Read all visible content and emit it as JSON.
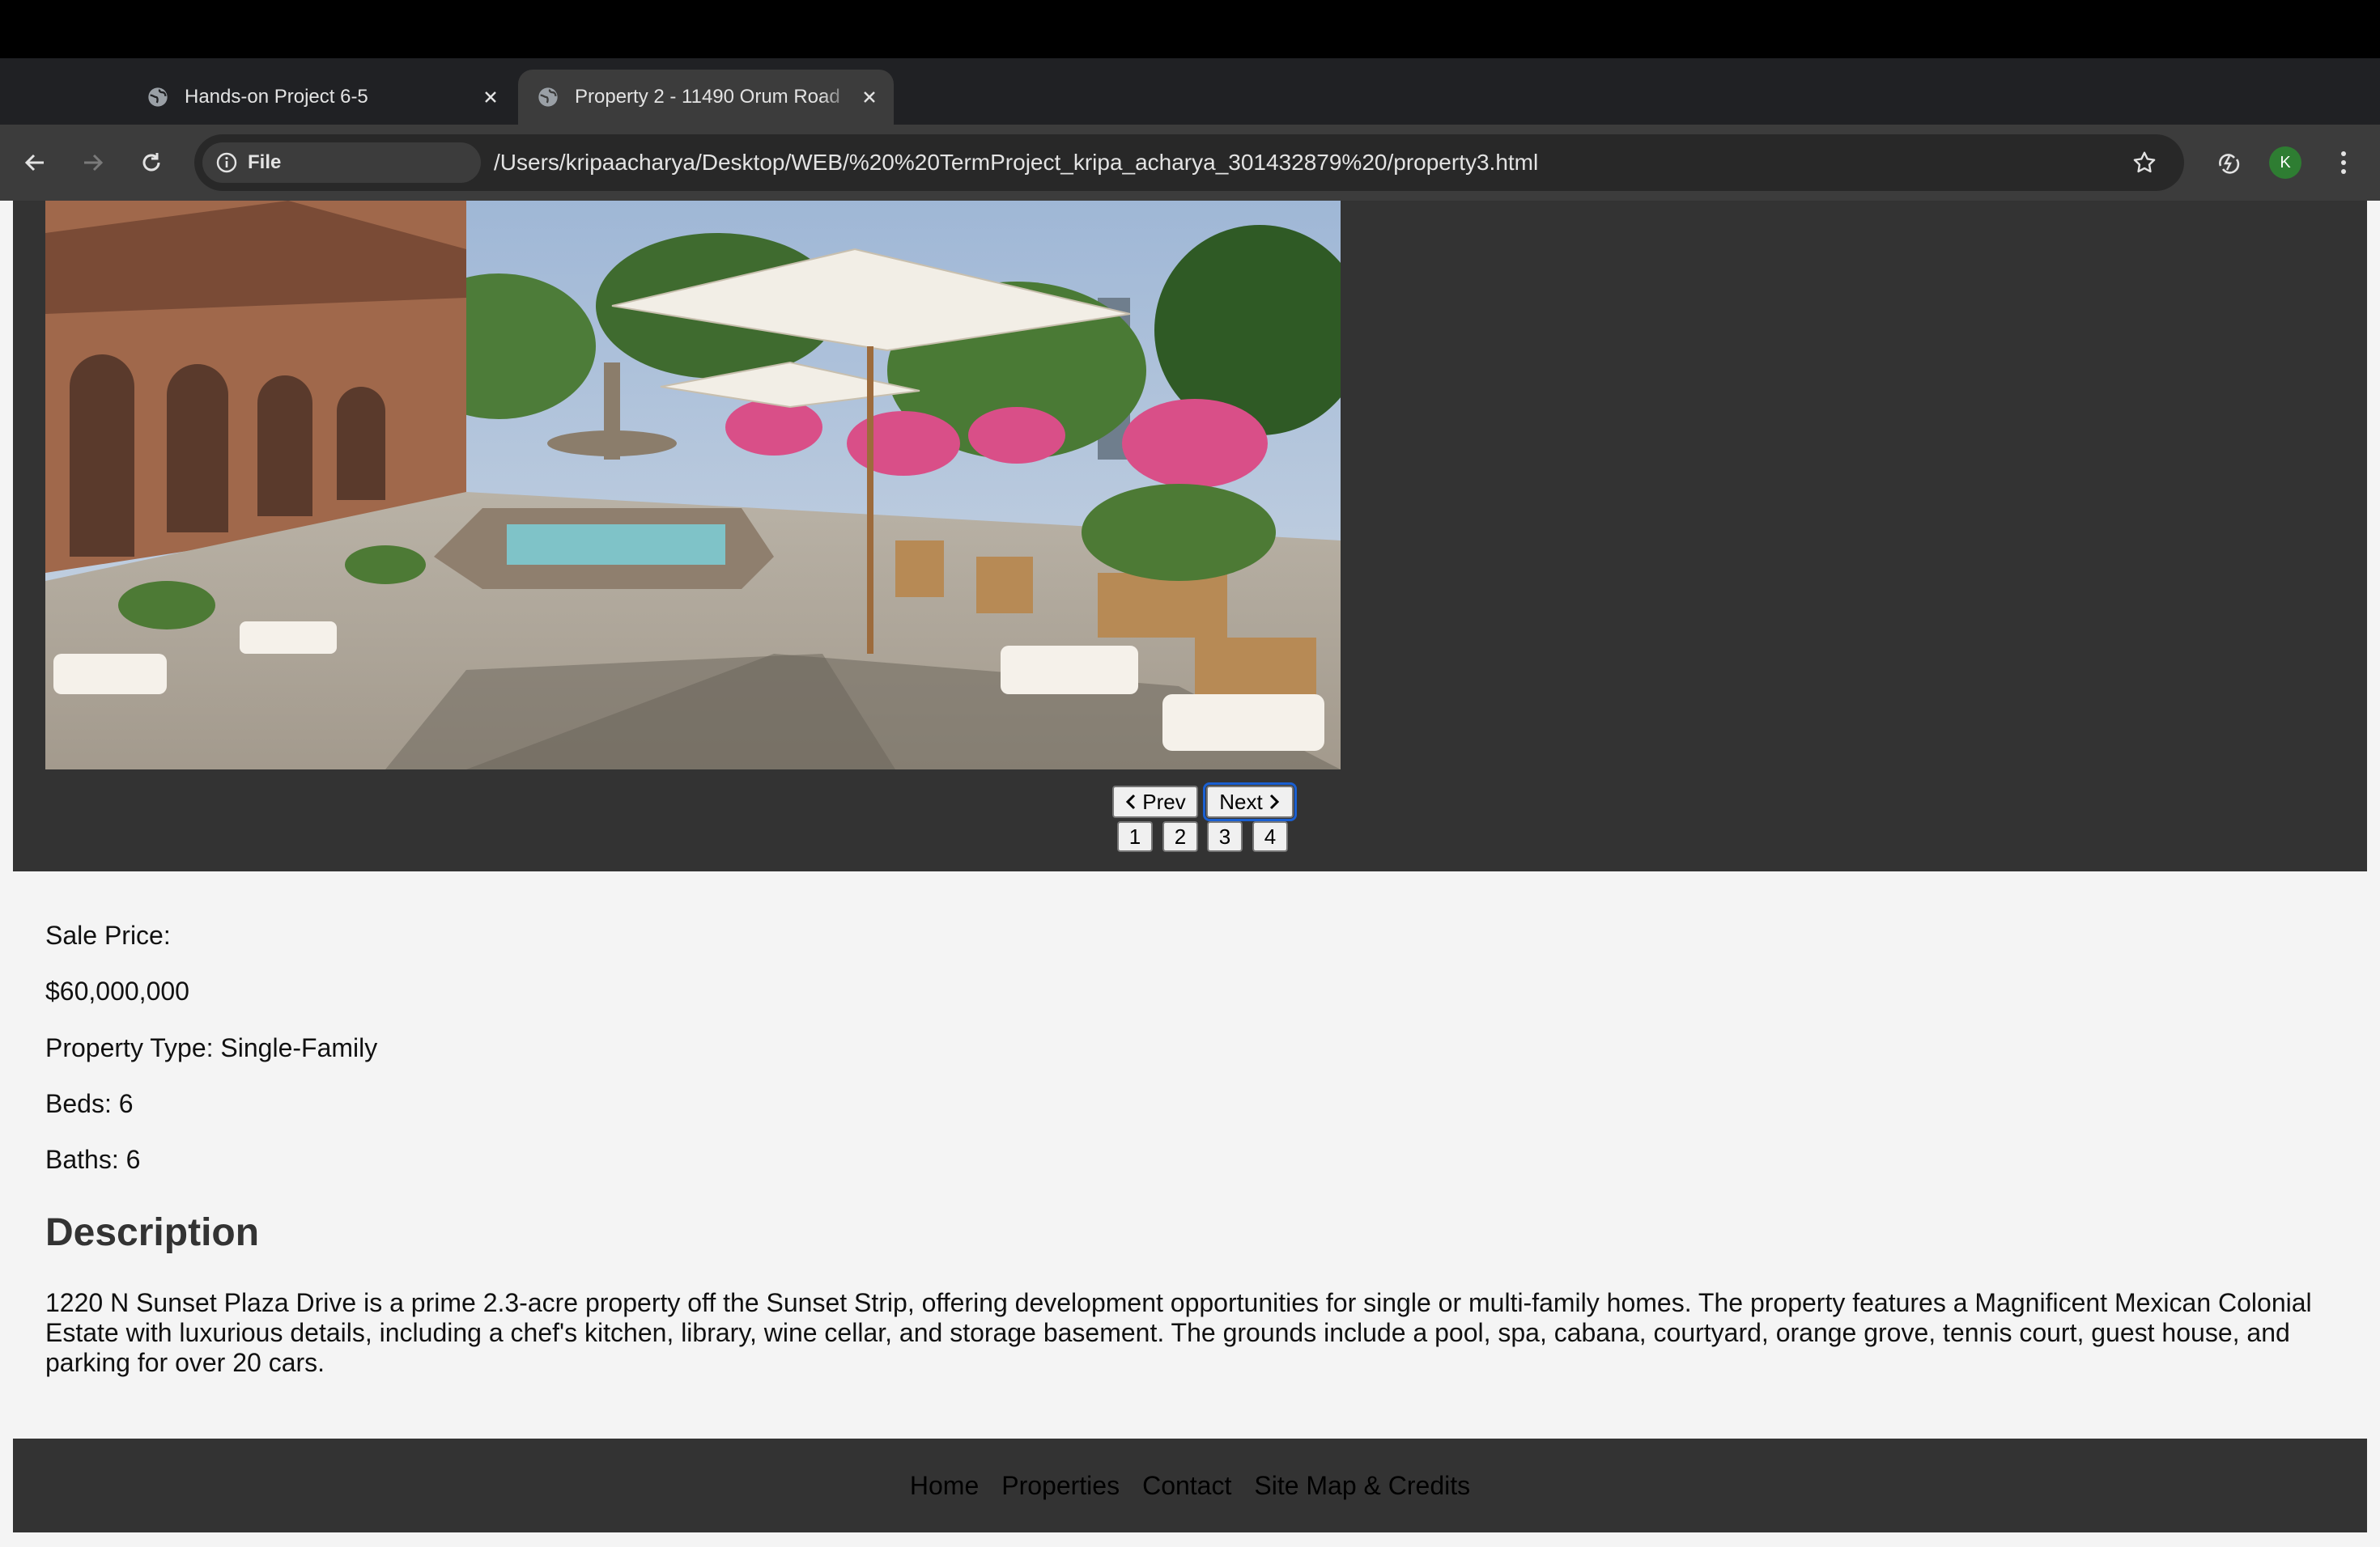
{
  "browser": {
    "tabs": [
      {
        "title": "Hands-on Project 6-5",
        "active": false
      },
      {
        "title": "Property 2 - 11490 Orum Road",
        "active": true
      }
    ],
    "address": {
      "scheme_label": "File",
      "url": "/Users/kripaacharya/Desktop/WEB/%20%20TermProject_kripa_acharya_301432879%20/property3.html"
    },
    "profile_initial": "K"
  },
  "gallery": {
    "prev_label": "Prev",
    "next_label": "Next",
    "slides": [
      "1",
      "2",
      "3",
      "4"
    ]
  },
  "details": {
    "sale_price_label": "Sale Price:",
    "sale_price": "$60,000,000",
    "property_type": "Property Type: Single-Family",
    "beds": "Beds: 6",
    "baths": "Baths: 6"
  },
  "description": {
    "heading": "Description",
    "text": "1220 N Sunset Plaza Drive is a prime 2.3-acre property off the Sunset Strip, offering development opportunities for single or multi-family homes. The property features a Magnificent Mexican Colonial Estate with luxurious details, including a chef's kitchen, library, wine cellar, and storage basement. The grounds include a pool, spa, cabana, courtyard, orange grove, tennis court, guest house, and parking for over 20 cars."
  },
  "footer": {
    "links": [
      "Home",
      "Properties",
      "Contact",
      "Site Map & Credits"
    ]
  },
  "colors": {
    "chrome_dark": "#202124",
    "toolbar": "#3c3c3c",
    "page_bg": "#f4f4f4",
    "panel_dark": "#333333",
    "focus_ring": "#1a5fd1",
    "avatar": "#2e7d32"
  }
}
